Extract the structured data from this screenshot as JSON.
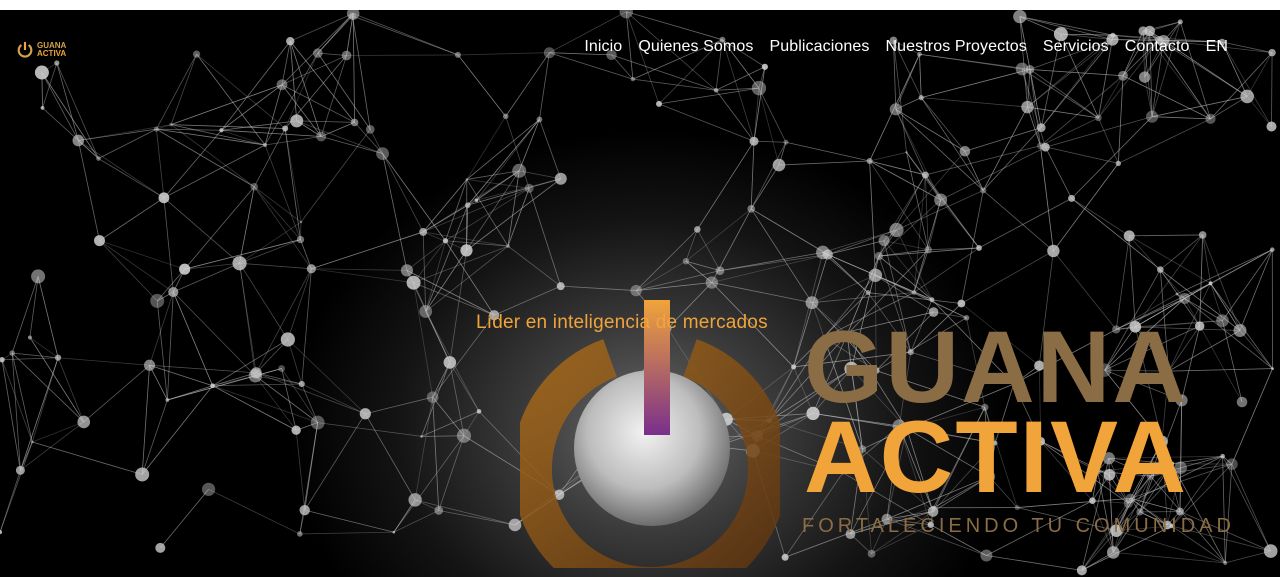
{
  "header": {
    "logo": {
      "word1": "GUANA",
      "word2": "ACTIVA",
      "icon": "power-icon"
    },
    "nav": [
      {
        "label": "Inicio"
      },
      {
        "label": "Quienes Somos"
      },
      {
        "label": "Publicaciones"
      },
      {
        "label": "Nuestros Proyectos"
      },
      {
        "label": "Servicios"
      },
      {
        "label": "Contacto"
      },
      {
        "label": "EN"
      }
    ]
  },
  "hero": {
    "tagline": "Líder en inteligencia de mercados",
    "brand_word_1": "GUANA",
    "brand_word_2": "ACTIVA",
    "brand_tagline": "FORTALECIENDO TU COMUNIDAD",
    "icon": "power-icon",
    "background": "network-graph"
  },
  "colors": {
    "accent": "#f0a43a",
    "muted_gold": "#8a6d45",
    "background": "#000000",
    "nav_text": "#ffffff"
  }
}
